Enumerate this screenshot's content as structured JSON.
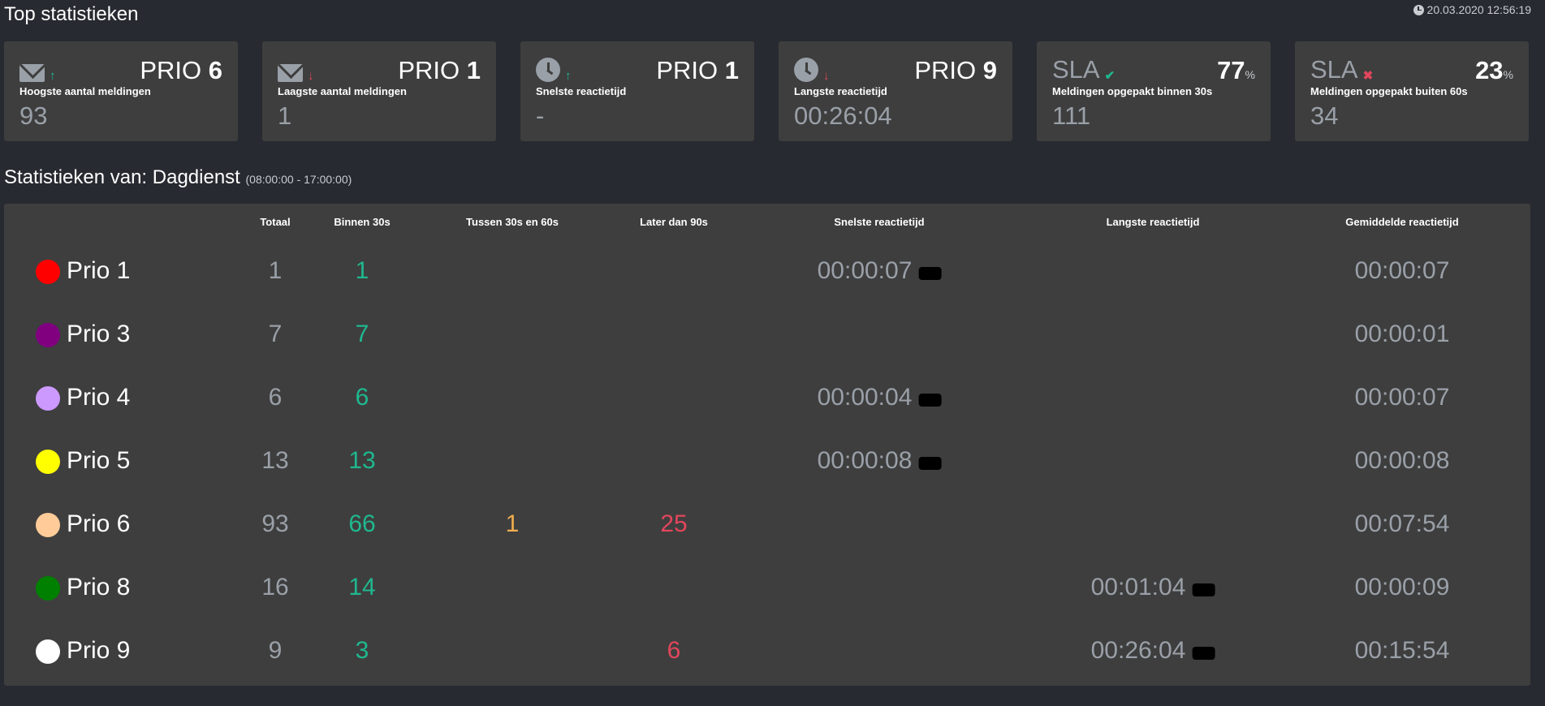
{
  "header": {
    "title": "Top statistieken",
    "timestamp": "20.03.2020 12:56:19"
  },
  "cards": [
    {
      "icon": "envelope-icon",
      "arrow": "↑",
      "prio_word": "PRIO",
      "prio_num": "6",
      "subtitle": "Hoogste aantal meldingen",
      "value": "93"
    },
    {
      "icon": "envelope-icon",
      "arrow": "↓",
      "prio_word": "PRIO",
      "prio_num": "1",
      "subtitle": "Laagste aantal meldingen",
      "value": "1"
    },
    {
      "icon": "clock-icon",
      "arrow": "↑",
      "prio_word": "PRIO",
      "prio_num": "1",
      "subtitle": "Snelste reactietijd",
      "value": "-"
    },
    {
      "icon": "clock-icon",
      "arrow": "↓",
      "prio_word": "PRIO",
      "prio_num": "9",
      "subtitle": "Langste reactietijd",
      "value": "00:26:04"
    },
    {
      "sla": "SLA",
      "mark": "✔",
      "percent": "77",
      "percent_sign": "%",
      "subtitle": "Meldingen opgepakt binnen 30s",
      "value": "111"
    },
    {
      "sla": "SLA",
      "mark": "✖",
      "percent": "23",
      "percent_sign": "%",
      "subtitle": "Meldingen opgepakt buiten 60s",
      "value": "34"
    }
  ],
  "section": {
    "title": "Statistieken van: Dagdienst",
    "range": "(08:00:00 - 17:00:00)"
  },
  "table": {
    "headers": [
      "Totaal",
      "Binnen 30s",
      "Tussen 30s en 60s",
      "Later dan 90s",
      "Snelste reactietijd",
      "Langste reactietijd",
      "Gemiddelde reactietijd"
    ],
    "rows": [
      {
        "label": "Prio 1",
        "color": "#ff0000",
        "totaal": "1",
        "binnen": "1",
        "tussen": "",
        "later": "",
        "snelste": "00:00:07",
        "langste": "",
        "gemiddelde": "00:00:07"
      },
      {
        "label": "Prio 3",
        "color": "#800080",
        "totaal": "7",
        "binnen": "7",
        "tussen": "",
        "later": "",
        "snelste": "",
        "langste": "",
        "gemiddelde": "00:00:01"
      },
      {
        "label": "Prio 4",
        "color": "#cc99ff",
        "totaal": "6",
        "binnen": "6",
        "tussen": "",
        "later": "",
        "snelste": "00:00:04",
        "langste": "",
        "gemiddelde": "00:00:07"
      },
      {
        "label": "Prio 5",
        "color": "#ffff00",
        "totaal": "13",
        "binnen": "13",
        "tussen": "",
        "later": "",
        "snelste": "00:00:08",
        "langste": "",
        "gemiddelde": "00:00:08"
      },
      {
        "label": "Prio 6",
        "color": "#ffcc99",
        "totaal": "93",
        "binnen": "66",
        "tussen": "1",
        "later": "25",
        "snelste": "",
        "langste": "",
        "gemiddelde": "00:07:54"
      },
      {
        "label": "Prio 8",
        "color": "#008000",
        "totaal": "16",
        "binnen": "14",
        "tussen": "",
        "later": "",
        "snelste": "",
        "langste": "00:01:04",
        "gemiddelde": "00:00:09"
      },
      {
        "label": "Prio 9",
        "color": "#ffffff",
        "totaal": "9",
        "binnen": "3",
        "tussen": "",
        "later": "6",
        "snelste": "",
        "langste": "00:26:04",
        "gemiddelde": "00:15:54"
      }
    ]
  },
  "colors": {
    "background": "#272a30",
    "panel": "#3e3e3e",
    "teal": "#1fb88f",
    "orange": "#f0ad4e",
    "red": "#e2465c",
    "muted": "#9aa0a8"
  }
}
